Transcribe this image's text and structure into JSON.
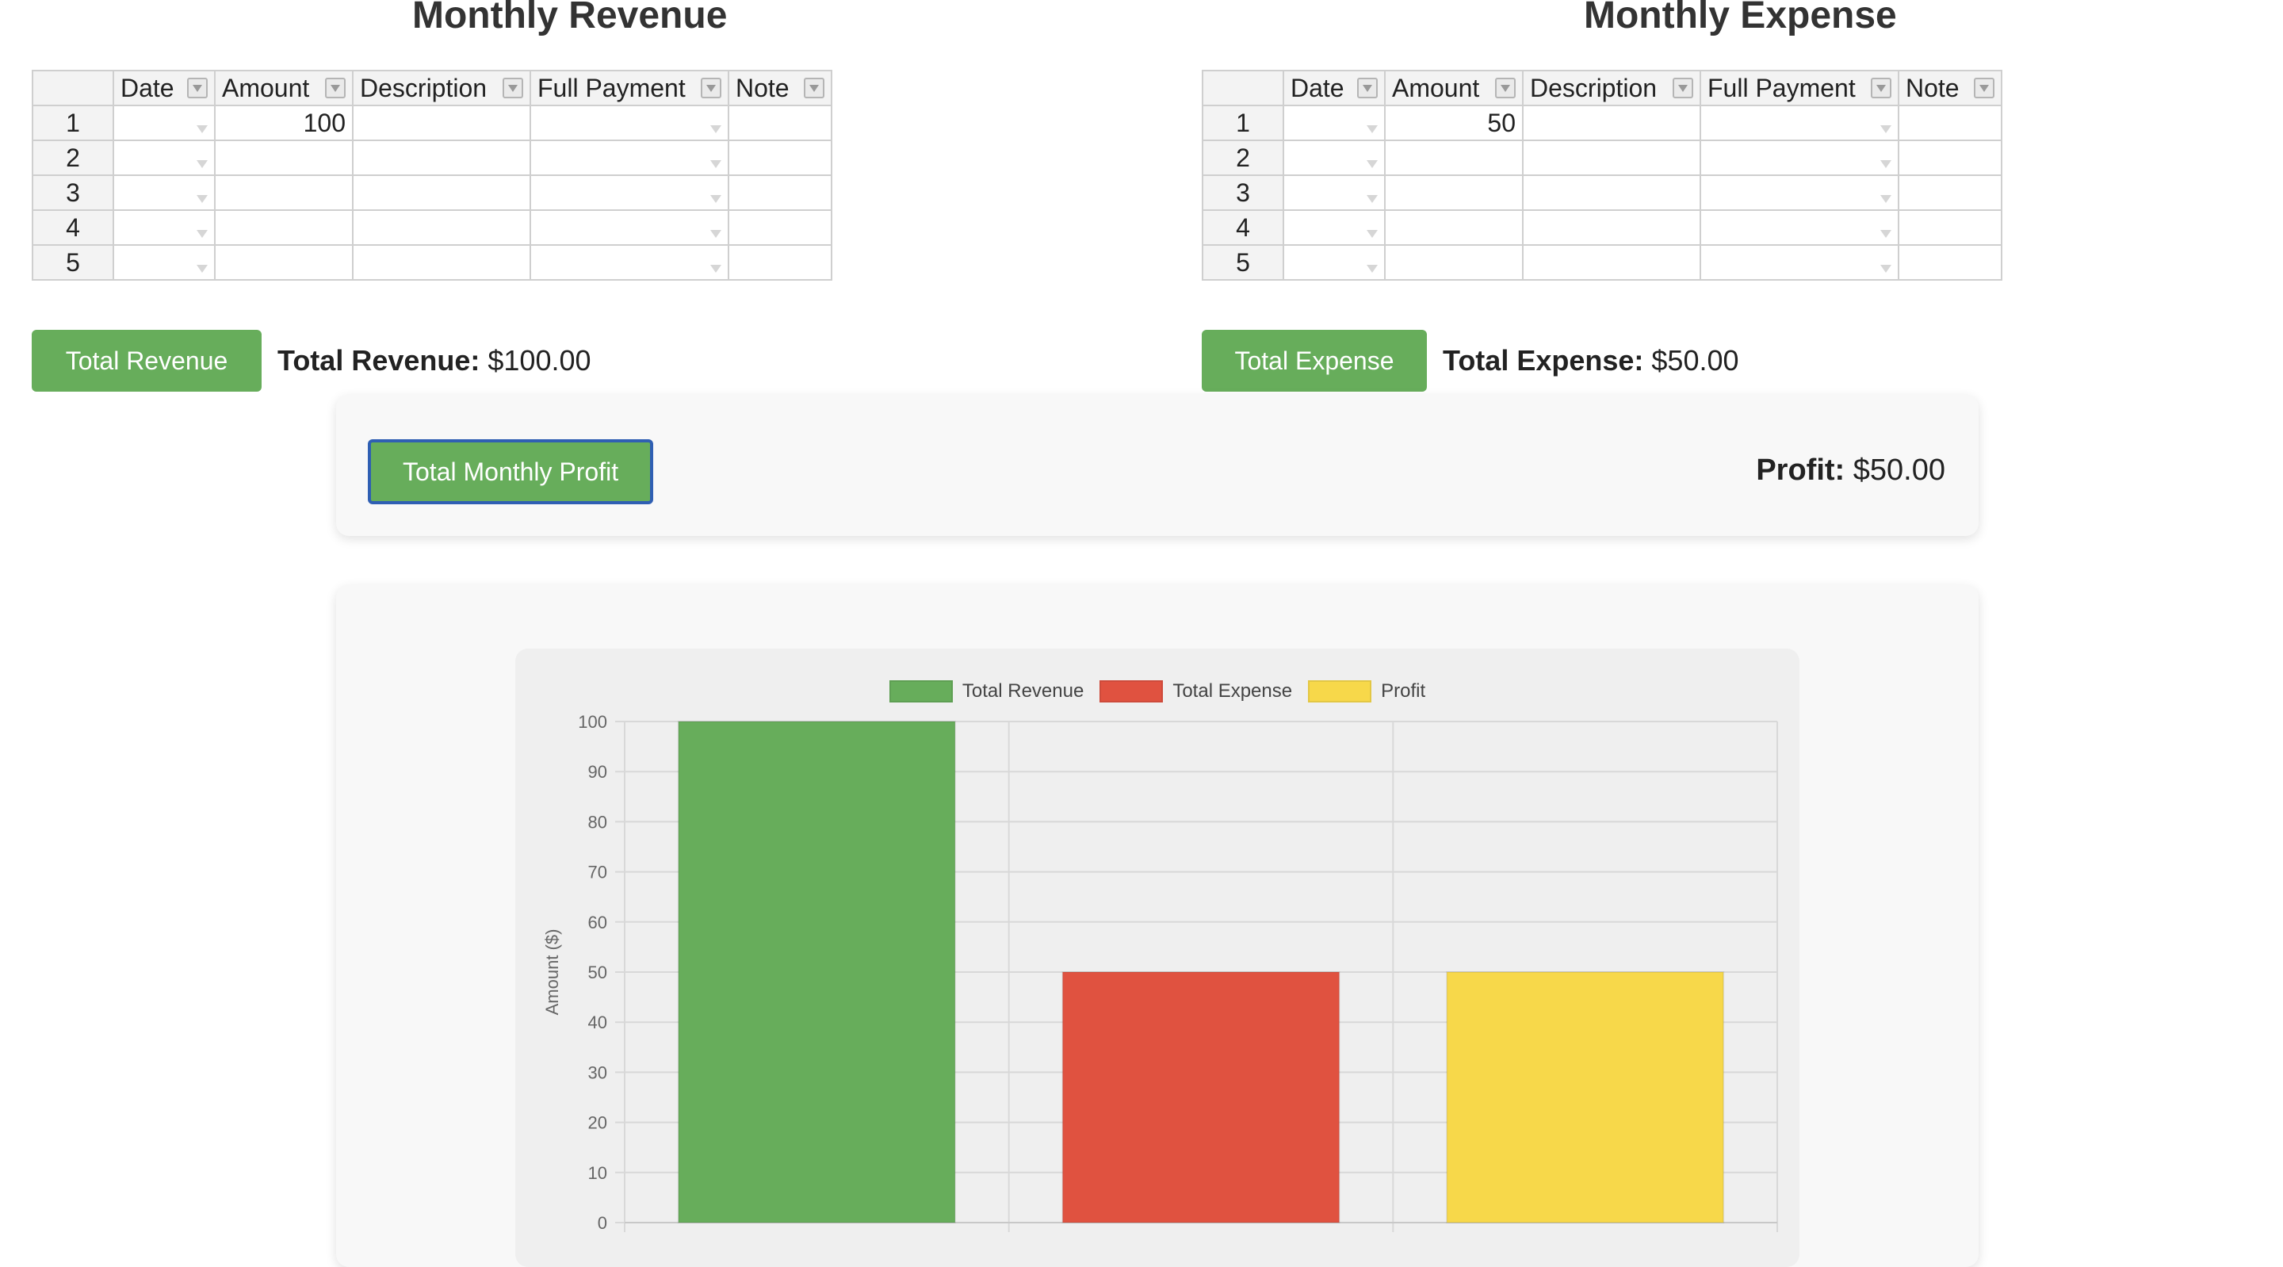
{
  "revenue": {
    "title": "Monthly Revenue",
    "columns": [
      "Date",
      "Amount",
      "Description",
      "Full Payment",
      "Note"
    ],
    "rows": [
      {
        "num": "1",
        "date": "",
        "amount": "100",
        "description": "",
        "full_payment": "",
        "note": ""
      },
      {
        "num": "2",
        "date": "",
        "amount": "",
        "description": "",
        "full_payment": "",
        "note": ""
      },
      {
        "num": "3",
        "date": "",
        "amount": "",
        "description": "",
        "full_payment": "",
        "note": ""
      },
      {
        "num": "4",
        "date": "",
        "amount": "",
        "description": "",
        "full_payment": "",
        "note": ""
      },
      {
        "num": "5",
        "date": "",
        "amount": "",
        "description": "",
        "full_payment": "",
        "note": ""
      }
    ],
    "button_label": "Total Revenue",
    "total_label": "Total Revenue:",
    "total_value": "$100.00"
  },
  "expense": {
    "title": "Monthly Expense",
    "columns": [
      "Date",
      "Amount",
      "Description",
      "Full Payment",
      "Note"
    ],
    "rows": [
      {
        "num": "1",
        "date": "",
        "amount": "50",
        "description": "",
        "full_payment": "",
        "note": ""
      },
      {
        "num": "2",
        "date": "",
        "amount": "",
        "description": "",
        "full_payment": "",
        "note": ""
      },
      {
        "num": "3",
        "date": "",
        "amount": "",
        "description": "",
        "full_payment": "",
        "note": ""
      },
      {
        "num": "4",
        "date": "",
        "amount": "",
        "description": "",
        "full_payment": "",
        "note": ""
      },
      {
        "num": "5",
        "date": "",
        "amount": "",
        "description": "",
        "full_payment": "",
        "note": ""
      }
    ],
    "button_label": "Total Expense",
    "total_label": "Total Expense:",
    "total_value": "$50.00"
  },
  "profit": {
    "button_label": "Total Monthly Profit",
    "label": "Profit:",
    "value": "$50.00"
  },
  "colors": {
    "accent_green": "#67ad5b",
    "revenue_bar": "#67ad5b",
    "expense_bar": "#e05240",
    "profit_bar": "#f7d84a",
    "focus_border": "#2f5fb3"
  },
  "icons": {
    "filter": "filter-dropdown-icon",
    "cell_dropdown": "dropdown-arrow-icon"
  },
  "chart_data": {
    "type": "bar",
    "categories": [
      "Total Revenue",
      "Total Expense",
      "Profit"
    ],
    "series": [
      {
        "name": "Total Revenue",
        "values": [
          100,
          null,
          null
        ],
        "color": "#67ad5b"
      },
      {
        "name": "Total Expense",
        "values": [
          null,
          50,
          null
        ],
        "color": "#e05240"
      },
      {
        "name": "Profit",
        "values": [
          null,
          null,
          50
        ],
        "color": "#f7d84a"
      }
    ],
    "title": "",
    "xlabel": "",
    "ylabel": "Amount ($)",
    "ylim": [
      0,
      100
    ],
    "yticks": [
      0,
      10,
      20,
      30,
      40,
      50,
      60,
      70,
      80,
      90,
      100
    ],
    "grid": true,
    "legend": "top"
  }
}
